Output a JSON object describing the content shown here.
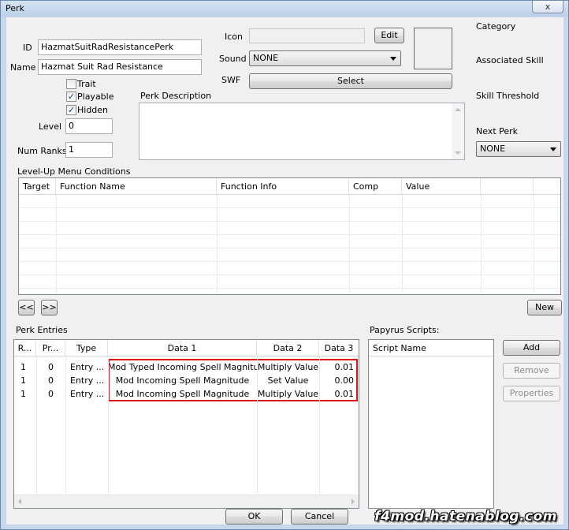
{
  "window": {
    "title": "Perk",
    "close_glyph": "x"
  },
  "fields": {
    "id_label": "ID",
    "id_value": "HazmatSuitRadResistancePerk",
    "name_label": "Name",
    "name_value": "Hazmat Suit Rad Resistance",
    "trait_label": "Trait",
    "trait_checked": false,
    "playable_label": "Playable",
    "playable_checked": true,
    "hidden_label": "Hidden",
    "hidden_checked": true,
    "level_label": "Level",
    "level_value": "0",
    "numranks_label": "Num Ranks",
    "numranks_value": "1",
    "icon_label": "Icon",
    "icon_value": "",
    "edit_button": "Edit",
    "sound_label": "Sound",
    "sound_value": "NONE",
    "swf_label": "SWF",
    "select_button": "Select",
    "description_label": "Perk Description",
    "description_value": "",
    "category_label": "Category",
    "associated_skill_label": "Associated Skill",
    "skill_threshold_label": "Skill Threshold",
    "next_perk_label": "Next Perk",
    "next_perk_value": "NONE",
    "check_glyph": "✓"
  },
  "conditions": {
    "label": "Level-Up Menu Conditions",
    "columns": [
      "Target",
      "Function Name",
      "Function Info",
      "Comp",
      "Value"
    ],
    "rows": [],
    "prev_button": "<<",
    "next_button": ">>",
    "new_button": "New"
  },
  "perk_entries": {
    "label": "Perk Entries",
    "columns": [
      "R...",
      "Pr...",
      "Type",
      "Data 1",
      "Data 2",
      "Data 3"
    ],
    "rows": [
      {
        "rank": "1",
        "priority": "0",
        "type": "Entry ...",
        "data1": "Mod Typed Incoming Spell Magnitude",
        "data2": "Multiply Value",
        "data3": "0.01"
      },
      {
        "rank": "1",
        "priority": "0",
        "type": "Entry ...",
        "data1": "Mod Incoming Spell Magnitude",
        "data2": "Set Value",
        "data3": "0.00"
      },
      {
        "rank": "1",
        "priority": "0",
        "type": "Entry ...",
        "data1": "Mod Incoming Spell Magnitude",
        "data2": "Multiply Value",
        "data3": "0.01"
      }
    ]
  },
  "papyrus": {
    "label": "Papyrus Scripts:",
    "column": "Script Name",
    "add_button": "Add",
    "remove_button": "Remove",
    "properties_button": "Properties"
  },
  "footer": {
    "ok_button": "OK",
    "cancel_button": "Cancel"
  },
  "watermark": "f4mod.hatenablog.com",
  "colors": {
    "highlight_box": "#e0151a",
    "window_frame": "#c7d8ec",
    "client_bg": "#f0f0f0"
  }
}
